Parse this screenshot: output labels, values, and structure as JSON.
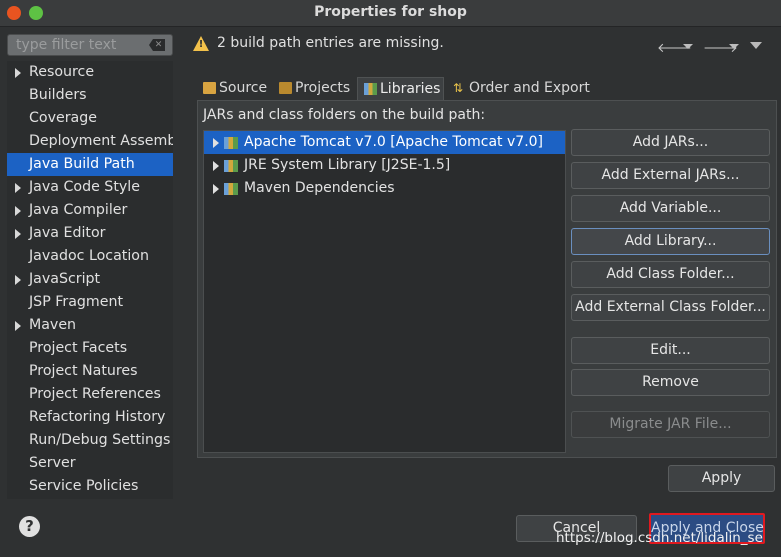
{
  "window": {
    "title": "Properties for shop"
  },
  "filter": {
    "placeholder": "type filter text"
  },
  "sidebar": {
    "items": [
      {
        "label": "Resource",
        "expandable": true
      },
      {
        "label": "Builders",
        "expandable": false
      },
      {
        "label": "Coverage",
        "expandable": false
      },
      {
        "label": "Deployment Assembly",
        "expandable": false
      },
      {
        "label": "Java Build Path",
        "expandable": false,
        "selected": true
      },
      {
        "label": "Java Code Style",
        "expandable": true
      },
      {
        "label": "Java Compiler",
        "expandable": true
      },
      {
        "label": "Java Editor",
        "expandable": true
      },
      {
        "label": "Javadoc Location",
        "expandable": false
      },
      {
        "label": "JavaScript",
        "expandable": true
      },
      {
        "label": "JSP Fragment",
        "expandable": false
      },
      {
        "label": "Maven",
        "expandable": true
      },
      {
        "label": "Project Facets",
        "expandable": false
      },
      {
        "label": "Project Natures",
        "expandable": false
      },
      {
        "label": "Project References",
        "expandable": false
      },
      {
        "label": "Refactoring History",
        "expandable": false
      },
      {
        "label": "Run/Debug Settings",
        "expandable": false
      },
      {
        "label": "Server",
        "expandable": false
      },
      {
        "label": "Service Policies",
        "expandable": false
      }
    ]
  },
  "message": {
    "text": "2 build path entries are missing."
  },
  "tabs": [
    {
      "label": "Source",
      "icon": "folder-icon"
    },
    {
      "label": "Projects",
      "icon": "projects-icon"
    },
    {
      "label": "Libraries",
      "icon": "libraries-icon",
      "active": true
    },
    {
      "label": "Order and Export",
      "icon": "order-icon"
    }
  ],
  "panel": {
    "label": "JARs and class folders on the build path:",
    "entries": [
      {
        "label": "Apache Tomcat v7.0 [Apache Tomcat v7.0]",
        "selected": true
      },
      {
        "label": "JRE System Library [J2SE-1.5]"
      },
      {
        "label": "Maven Dependencies"
      }
    ]
  },
  "buttons": {
    "add_jars": "Add JARs...",
    "add_external_jars": "Add External JARs...",
    "add_variable": "Add Variable...",
    "add_library": "Add Library...",
    "add_class_folder": "Add Class Folder...",
    "add_external_class_folder": "Add External Class Folder...",
    "edit": "Edit...",
    "remove": "Remove",
    "migrate_jar": "Migrate JAR File...",
    "apply": "Apply",
    "cancel": "Cancel",
    "apply_and_close": "Apply and Close",
    "help": "?"
  },
  "watermark": "https://blog.csdn.net/lidalin_se",
  "colors": {
    "selection": "#1c62c4",
    "highlight_border": "#e0191f",
    "warning": "#f2c14b"
  }
}
